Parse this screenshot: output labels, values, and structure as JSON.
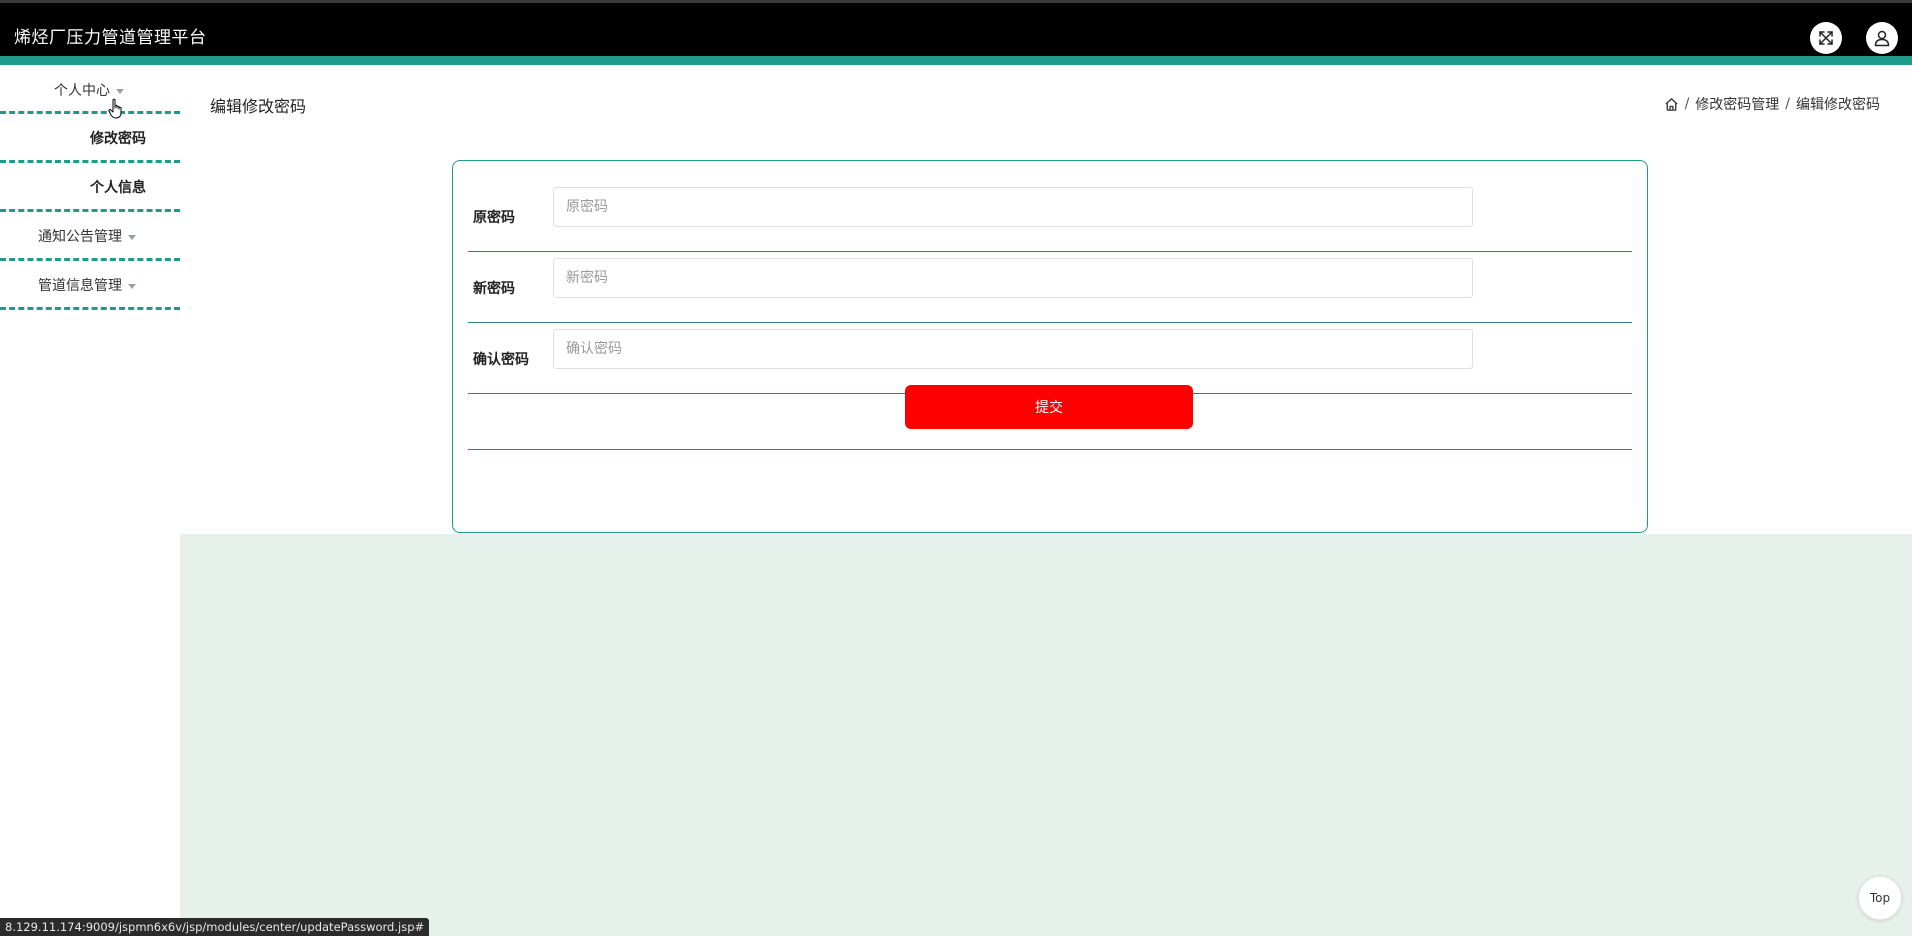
{
  "header": {
    "title": "烯烃厂压力管道管理平台",
    "fullscreen_icon": "expand-icon",
    "user_icon": "user-icon"
  },
  "sidebar": {
    "items": [
      {
        "label": "个人中心",
        "expandable": true
      },
      {
        "label": "修改密码",
        "expandable": false
      },
      {
        "label": "个人信息",
        "expandable": false
      },
      {
        "label": "通知公告管理",
        "expandable": true
      },
      {
        "label": "管道信息管理",
        "expandable": true
      }
    ]
  },
  "main": {
    "page_title": "编辑修改密码",
    "breadcrumb": {
      "home_icon": "home-icon",
      "separator": "/",
      "items": [
        "修改密码管理",
        "编辑修改密码"
      ]
    },
    "form": {
      "fields": [
        {
          "label": "原密码",
          "placeholder": "原密码",
          "value": ""
        },
        {
          "label": "新密码",
          "placeholder": "新密码",
          "value": ""
        },
        {
          "label": "确认密码",
          "placeholder": "确认密码",
          "value": ""
        }
      ],
      "submit_label": "提交"
    }
  },
  "top_button_label": "Top",
  "status_bar_url": "8.129.11.174:9009/jspmn6x6v/jsp/modules/center/updatePassword.jsp#",
  "colors": {
    "header_bg": "#000000",
    "accent": "#1d9a8a",
    "submit_bg": "#ff0000",
    "content_bg": "#e6f1ec"
  }
}
